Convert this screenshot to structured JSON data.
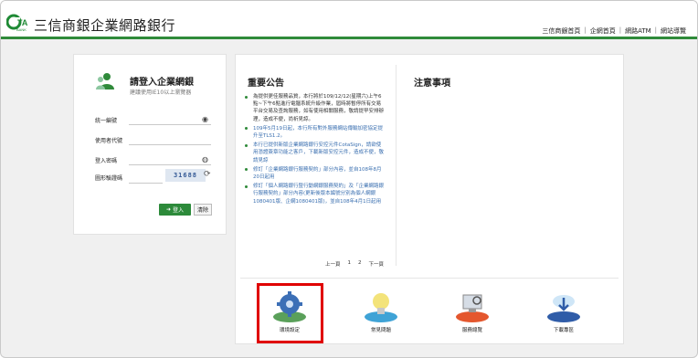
{
  "header": {
    "brand": "三信商銀企業網路銀行",
    "logo_text": "CTA BANK",
    "links": [
      "三信商銀首頁",
      "企網首頁",
      "網路ATM",
      "網站導覽"
    ]
  },
  "login": {
    "title": "請登入企業網銀",
    "subtitle": "建議使用IE10以上瀏覽器",
    "fields": [
      {
        "label": "統一編號"
      },
      {
        "label": "使用者代號"
      },
      {
        "label": "登入密碼"
      },
      {
        "label": "圖形驗證碼"
      }
    ],
    "captcha": "31688",
    "login_button": "登入",
    "clear_button": "清除"
  },
  "announcements": {
    "title": "重要公告",
    "items": [
      {
        "text": "為提供更佳服務品質，本行將於109/12/12(星期六)上午6點~下午6點進行電腦系統升級作業，屆時將暫停所有交易平台交易及查詢服務，如有使用相關服務，敬請提早安排辦理，造成不便，尚祈見諒。",
        "style": "normal"
      },
      {
        "text": "109年5月19日起，本行所有對外服務網站傳輸加密協定提升至TLS1.2。",
        "style": "blue"
      },
      {
        "text": "本行已提供新版企業網路銀行安控元件CotaSign，請欲使用憑證簽章功能之客戶，下載新版安控元件，造成不便，敬請見諒",
        "style": "blue"
      },
      {
        "text": "修訂「企業網路銀行服務契約」部分內容，並自108年8月20日起用",
        "style": "blue"
      },
      {
        "text": "修訂「個人網路銀行暨行動網銀服務契約」及「企業網路銀行服務契約」部分內容(更新後版本編號分別為個人網銀1080401版、企網1080401版)，並自108年4月1日起用",
        "style": "blue"
      }
    ],
    "pager": [
      "上一頁",
      "1",
      "2",
      "下一頁"
    ]
  },
  "notes": {
    "title": "注意事項"
  },
  "services": [
    {
      "label": "環境設定",
      "icon": "gear-icon"
    },
    {
      "label": "常見問題",
      "icon": "lightbulb-icon"
    },
    {
      "label": "服務總覽",
      "icon": "monitor-icon"
    },
    {
      "label": "下載專區",
      "icon": "cloud-download-icon"
    }
  ],
  "colors": {
    "brand_green": "#2f8a3a",
    "highlight": "#e00000",
    "link_blue": "#3a6fb0"
  }
}
